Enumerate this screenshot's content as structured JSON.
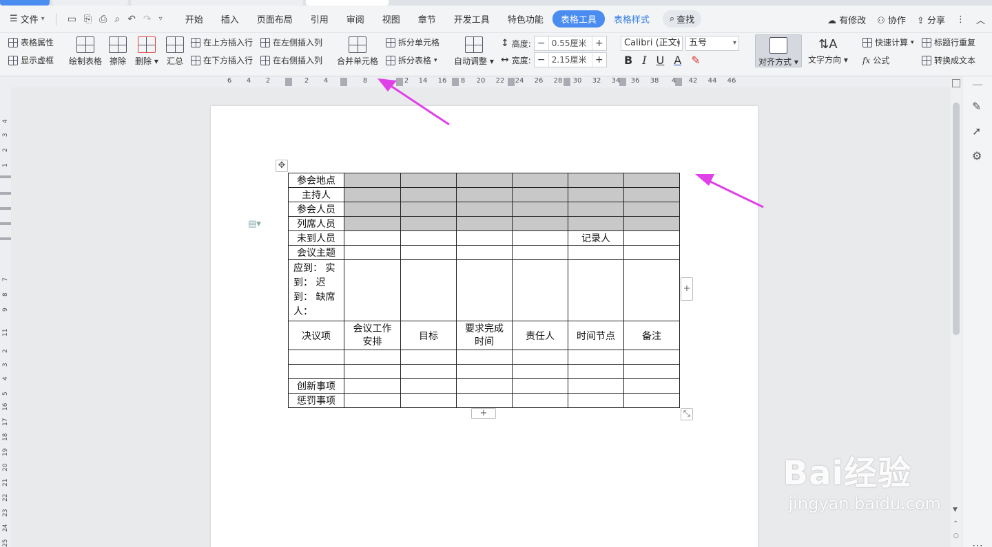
{
  "menubar": {
    "file_label": "文件",
    "tabs": [
      "开始",
      "插入",
      "页面布局",
      "引用",
      "审阅",
      "视图",
      "章节",
      "开发工具",
      "特色功能"
    ],
    "active_tab": "表格工具",
    "style_tab": "表格样式",
    "find": "查找",
    "right": {
      "modified": "有修改",
      "collab": "协作",
      "share": "分享"
    }
  },
  "ribbon": {
    "table_props": "表格属性",
    "show_gridlines": "显示虚框",
    "draw_table": "绘制表格",
    "erase": "擦除",
    "delete": "删除",
    "summary": "汇总",
    "insert_above": "在上方插入行",
    "insert_below": "在下方插入行",
    "insert_left": "在左侧插入列",
    "insert_right": "在右侧插入列",
    "merge_cells": "合并单元格",
    "split_cells": "拆分单元格",
    "split_table": "拆分表格",
    "auto_fit": "自动调整",
    "height_label": "高度:",
    "height_value": "0.55厘米",
    "width_label": "宽度:",
    "width_value": "2.15厘米",
    "font_name": "Calibri (正文)",
    "font_size": "五号",
    "align": "对齐方式",
    "text_dir": "文字方向",
    "quick_calc": "快速计算",
    "repeat_header": "标题行重复",
    "formula": "公式",
    "to_text": "转换成文本"
  },
  "hruler_labels": [
    "6",
    "4",
    "2",
    "2",
    "4",
    "8",
    "2",
    "14",
    "16",
    "8",
    "20",
    "22",
    "24",
    "26",
    "28",
    "30",
    "32",
    "34",
    "36",
    "38",
    "4",
    "42",
    "44",
    "46"
  ],
  "vruler_labels": [
    "4",
    "3",
    "2",
    "1",
    "7",
    "8",
    "9",
    "11",
    "2",
    "3",
    "4",
    "5",
    "16",
    "17",
    "18",
    "19",
    "20",
    "21",
    "22",
    "23",
    "24",
    "25",
    "26"
  ],
  "table": {
    "label_col": [
      "参会地点",
      "主持人",
      "参会人员",
      "列席人员",
      "未到人员",
      "会议主题"
    ],
    "recorder": "记录人",
    "attendance": "应到： 实到： 迟到： 缺席人：",
    "headers": [
      "决议项",
      "会议工作安排",
      "目标",
      "要求完成时间",
      "责任人",
      "时间节点",
      "备注"
    ],
    "bottom_rows": [
      "创新事项",
      "惩罚事项"
    ]
  },
  "watermark": {
    "brand": "Bai经验",
    "url": "jingyan.baidu.com"
  },
  "colors": {
    "accent": "#4a8cf0",
    "arrow": "#e040e8",
    "shade": "#c8c8c8"
  }
}
